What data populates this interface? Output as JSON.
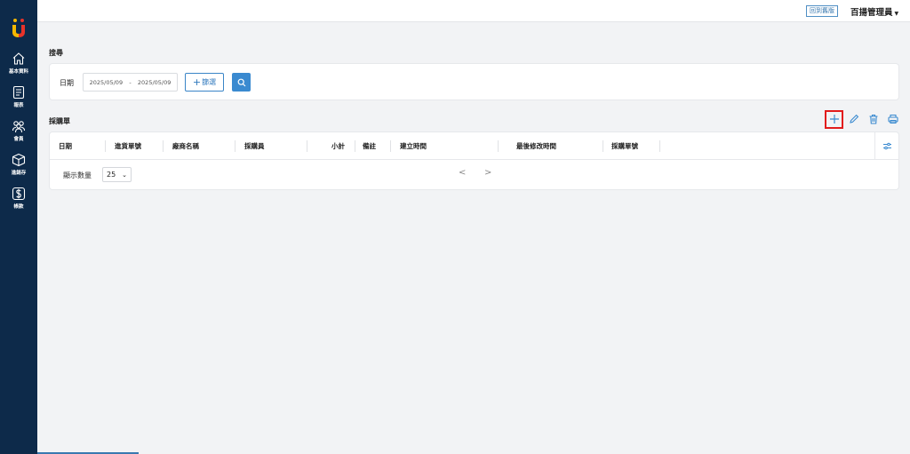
{
  "sidebar": {
    "items": [
      {
        "label": "基本資料",
        "icon": "home-icon"
      },
      {
        "label": "報表",
        "icon": "report-icon"
      },
      {
        "label": "會員",
        "icon": "members-icon"
      },
      {
        "label": "進銷存",
        "icon": "inventory-box-icon"
      },
      {
        "label": "帳款",
        "icon": "dollar-icon"
      }
    ]
  },
  "topbar": {
    "old_version_label": "回到舊版",
    "user_name": "百揚管理員"
  },
  "search": {
    "section_title": "搜尋",
    "date_label": "日期",
    "date_start": "2025/05/09",
    "date_separator": "-",
    "date_end": "2025/05/09",
    "filter_label": "篩選"
  },
  "table": {
    "section_title": "採購單",
    "columns": [
      "日期",
      "進貨單號",
      "廠商名稱",
      "採購員",
      "小計",
      "備註",
      "建立時間",
      "最後修改時間",
      "採購單號"
    ],
    "rows": [],
    "page_size_label": "顯示數量",
    "page_size_value": "25",
    "prev_label": "<",
    "next_label": ">"
  },
  "colors": {
    "sidebar_bg": "#0d2a4a",
    "accent": "#3a8ad0",
    "highlight": "#e21c1c"
  }
}
